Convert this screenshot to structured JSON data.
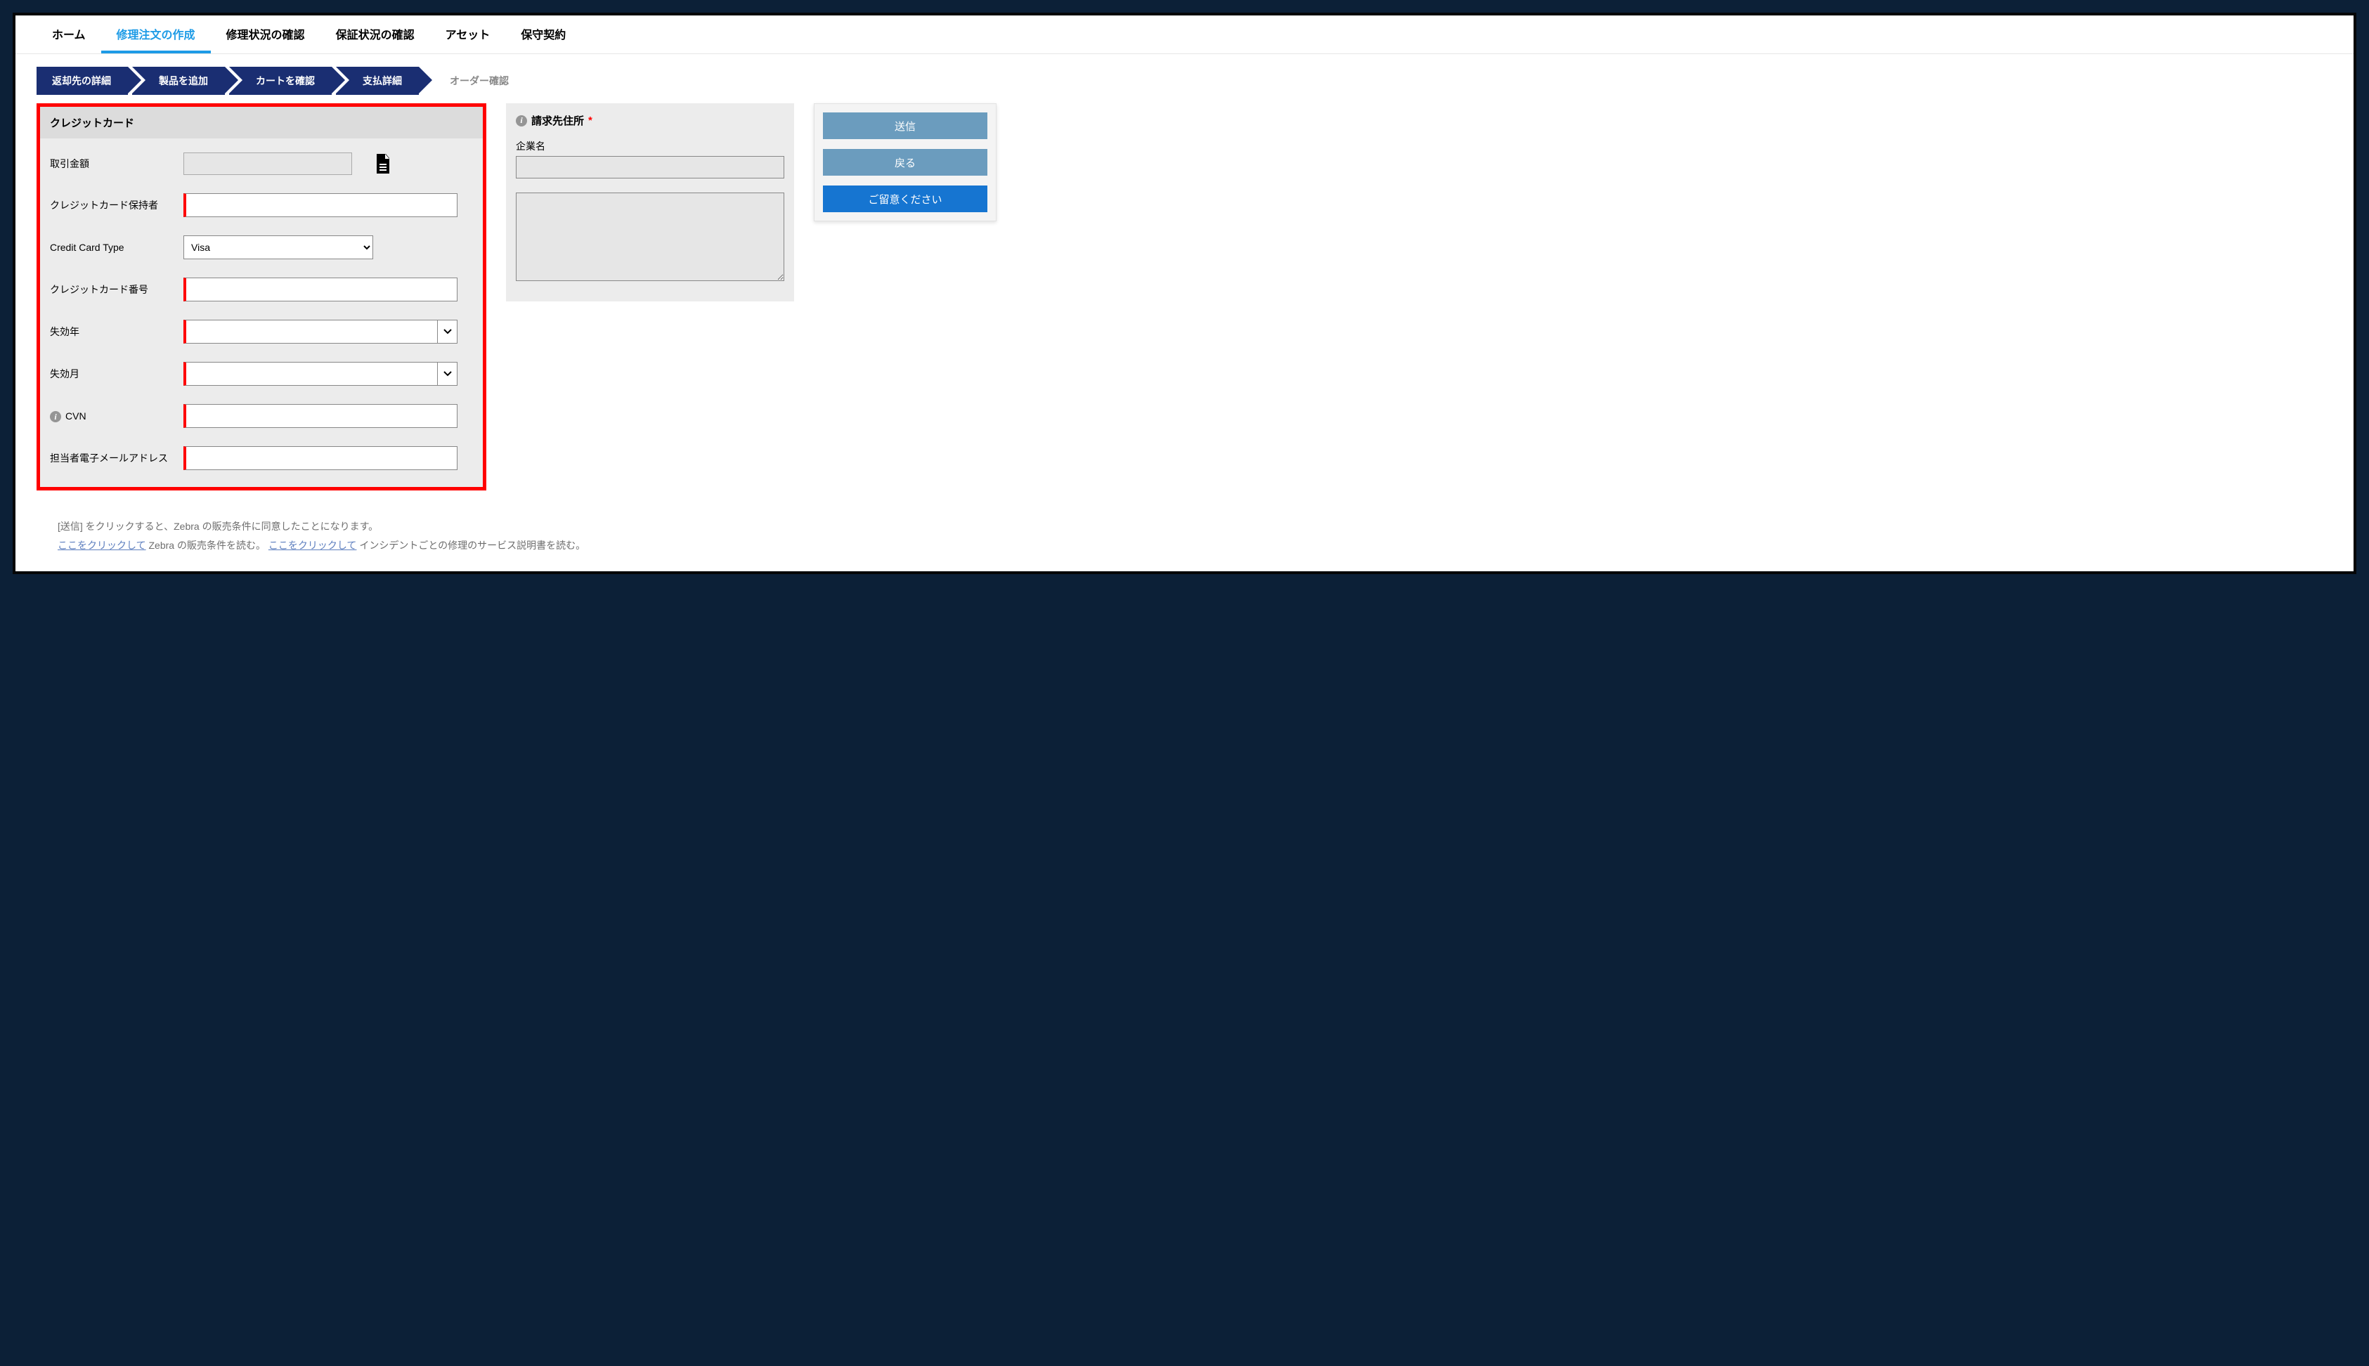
{
  "nav": {
    "home": "ホーム",
    "create_repair": "修理注文の作成",
    "repair_status": "修理状況の確認",
    "warranty_status": "保証状況の確認",
    "assets": "アセット",
    "maintenance": "保守契約"
  },
  "wizard": {
    "step1": "返却先の詳細",
    "step2": "製品を追加",
    "step3": "カートを確認",
    "step4": "支払詳細",
    "step5": "オーダー確認"
  },
  "cc": {
    "heading": "クレジットカード",
    "amount_label": "取引金額",
    "amount_value": "",
    "holder_label": "クレジットカード保持者",
    "holder_value": "",
    "type_label": "Credit Card Type",
    "type_value": "Visa",
    "number_label": "クレジットカード番号",
    "number_value": "",
    "exp_year_label": "失効年",
    "exp_year_value": "",
    "exp_month_label": "失効月",
    "exp_month_value": "",
    "cvn_label": "CVN",
    "cvn_value": "",
    "email_label": "担当者電子メールアドレス",
    "email_value": ""
  },
  "billing": {
    "heading": "請求先住所",
    "company_label": "企業名",
    "company_value": "",
    "address_value": ""
  },
  "actions": {
    "submit": "送信",
    "back": "戻る",
    "note": "ご留意ください"
  },
  "footer": {
    "line1_prefix": "[送信] をクリックすると、Zebra の販売条件に同意したことになります。",
    "link1": "ここをクリックして",
    "line2_mid": " Zebra の販売条件を読む。 ",
    "link2": "ここをクリックして",
    "line2_end": " インシデントごとの修理のサービス説明書を読む。"
  }
}
